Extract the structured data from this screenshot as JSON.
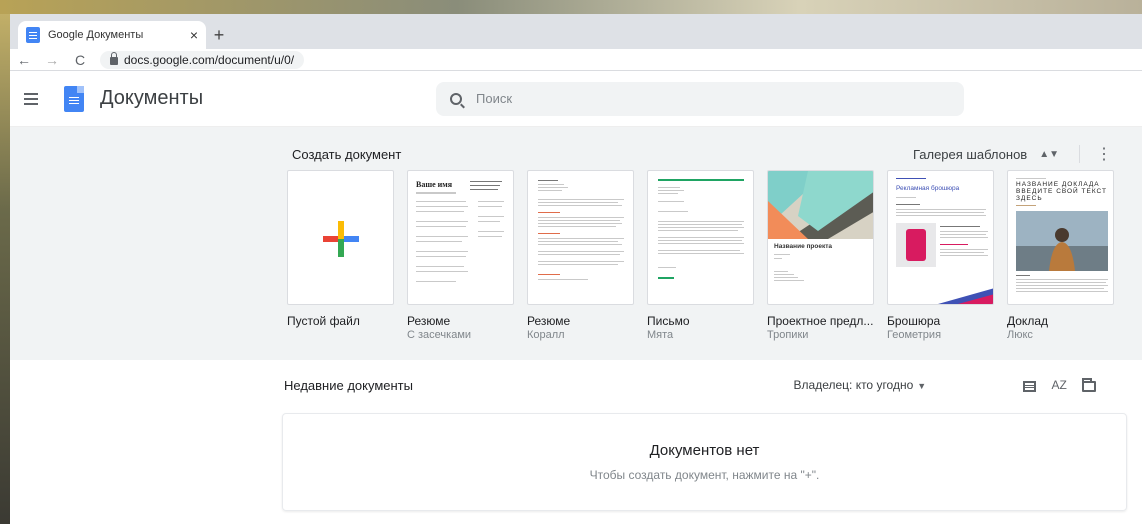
{
  "browser": {
    "tab_title": "Google Документы",
    "tab_close": "×",
    "new_tab": "+",
    "back": "←",
    "forward": "→",
    "reload": "C",
    "url": "docs.google.com/document/u/0/"
  },
  "app": {
    "title": "Документы",
    "search_placeholder": "Поиск"
  },
  "gallery": {
    "create_label": "Создать документ",
    "gallery_label": "Галерея шаблонов",
    "templates": [
      {
        "name": "Пустой файл",
        "sub": ""
      },
      {
        "name": "Резюме",
        "sub": "С засечками"
      },
      {
        "name": "Резюме",
        "sub": "Коралл"
      },
      {
        "name": "Письмо",
        "sub": "Мята"
      },
      {
        "name": "Проектное предл...",
        "sub": "Тропики"
      },
      {
        "name": "Брошюра",
        "sub": "Геометрия"
      },
      {
        "name": "Доклад",
        "sub": "Люкс"
      }
    ],
    "thumb_text": {
      "resume_name": "Ваше имя",
      "project_title": "Название проекта",
      "brochure_title": "Рекламная брошюра",
      "report_title": "НАЗВАНИЕ ДОКЛАДА ВВЕДИТЕ СВОЙ ТЕКСТ ЗДЕСЬ"
    }
  },
  "recent": {
    "title": "Недавние документы",
    "owner_filter": "Владелец: кто угодно",
    "sort_label": "AZ",
    "empty_title": "Документов нет",
    "empty_sub": "Чтобы создать документ, нажмите на \"+\"."
  },
  "colors": {
    "docs_blue": "#4285f4",
    "google_red": "#ea4335",
    "google_yellow": "#fbbc05",
    "google_green": "#34a853",
    "mint": "#1fa463",
    "coral": "#e06c4a",
    "brochure_pink": "#d81b60"
  }
}
